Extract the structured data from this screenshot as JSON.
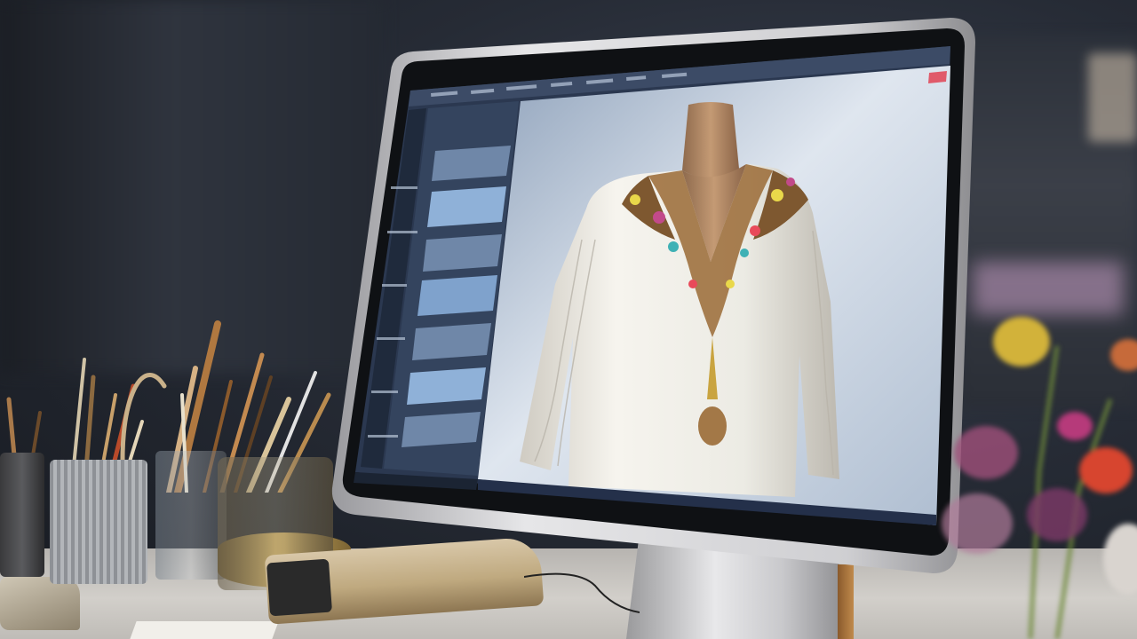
{
  "scene": {
    "subject": "",
    "colors": {
      "background": "#262b35",
      "desk": "#cfccc7",
      "monitor_bezel": "#0f1114",
      "monitor_frame": "#c8c8cb",
      "screen_ui": "#2b3850",
      "garment": "#f1efe8",
      "mannequin": "#b58c67",
      "embroidery": "#9a6a35"
    }
  },
  "monitor": {
    "icons": [
      "layers-icon",
      "brush-icon",
      "crop-icon",
      "text-icon",
      "move-icon",
      "zoom-icon"
    ]
  }
}
